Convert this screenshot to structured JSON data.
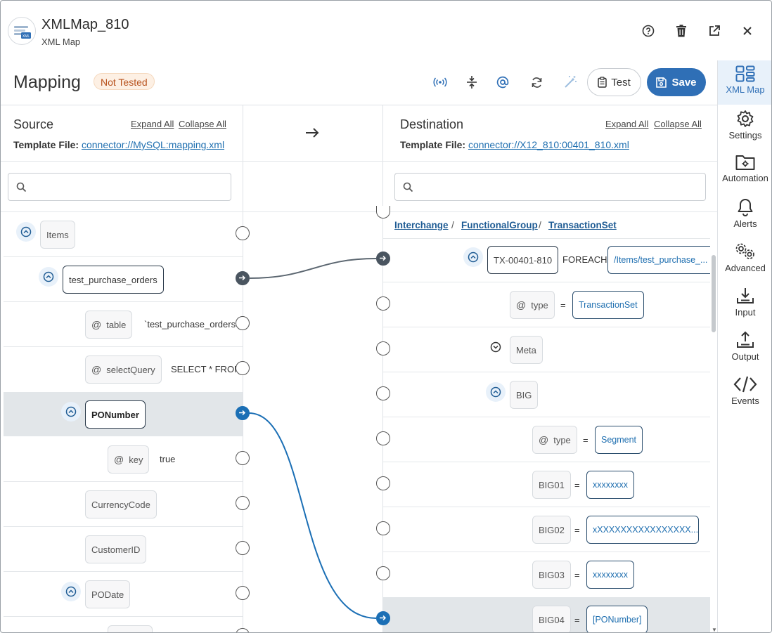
{
  "header": {
    "title": "XMLMap_810",
    "subtitle": "XML Map",
    "icons": [
      "help-icon",
      "trash-icon",
      "open-external-icon",
      "close-icon"
    ]
  },
  "toolbar": {
    "title": "Mapping",
    "status_badge": "Not Tested",
    "tools": [
      "broadcast-icon",
      "collapse-vertical-icon",
      "at-icon",
      "refresh-icon",
      "magic-wand-icon"
    ],
    "test_label": "Test",
    "save_label": "Save"
  },
  "rail": {
    "items": [
      {
        "label": "XML Map",
        "icon": "xml-map-icon",
        "active": true
      },
      {
        "label": "Settings",
        "icon": "gear-icon"
      },
      {
        "label": "Automation",
        "icon": "automation-folder-icon"
      },
      {
        "label": "Alerts",
        "icon": "bell-icon"
      },
      {
        "label": "Advanced",
        "icon": "gears-icon"
      },
      {
        "label": "Input",
        "icon": "input-tray-icon"
      },
      {
        "label": "Output",
        "icon": "output-tray-icon"
      },
      {
        "label": "Events",
        "icon": "code-icon"
      }
    ]
  },
  "source": {
    "title": "Source",
    "expand_all": "Expand All",
    "collapse_all": "Collapse All",
    "template_label": "Template File:",
    "template_file": "connector://MySQL:mapping.xml",
    "search_placeholder": "",
    "nodes": {
      "items": "Items",
      "orders": "test_purchase_orders",
      "table_attr": "table",
      "table_value": "`test_purchase_orders`",
      "query_attr": "selectQuery",
      "query_value": "SELECT * FROM",
      "ponumber": "PONumber",
      "key_attr": "key",
      "key_value": "true",
      "currency": "CurrencyCode",
      "customer": "CustomerID",
      "podate": "PODate"
    }
  },
  "destination": {
    "title": "Destination",
    "expand_all": "Expand All",
    "collapse_all": "Collapse All",
    "template_label": "Template File:",
    "template_file": "connector://X12_810:00401_810.xml",
    "search_placeholder": "",
    "breadcrumb": [
      "Interchange",
      "FunctionalGroup",
      "TransactionSet"
    ],
    "nodes": {
      "tx": "TX-00401-810",
      "foreach": "FOREACH",
      "foreach_value": "/Items/test_purchase_...",
      "type_attr": "type",
      "type_value": "TransactionSet",
      "meta": "Meta",
      "big": "BIG",
      "big_type_attr": "type",
      "big_type_value": "Segment",
      "big01": "BIG01",
      "big01_value": "xxxxxxxx",
      "big02": "BIG02",
      "big02_value": "xXXXXXXXXXXXXXXXX...",
      "big03": "BIG03",
      "big03_value": "xxxxxxxx",
      "big04": "BIG04",
      "big04_value": "[PONumber]",
      "equals": "="
    }
  },
  "colors": {
    "accent": "#2f6fb6",
    "link": "#1f6fb0",
    "badge_bg": "#fdf0e4",
    "badge_text": "#b8521d",
    "connector_dark": "#5b6670",
    "connector_blue": "#1b6fb5"
  }
}
